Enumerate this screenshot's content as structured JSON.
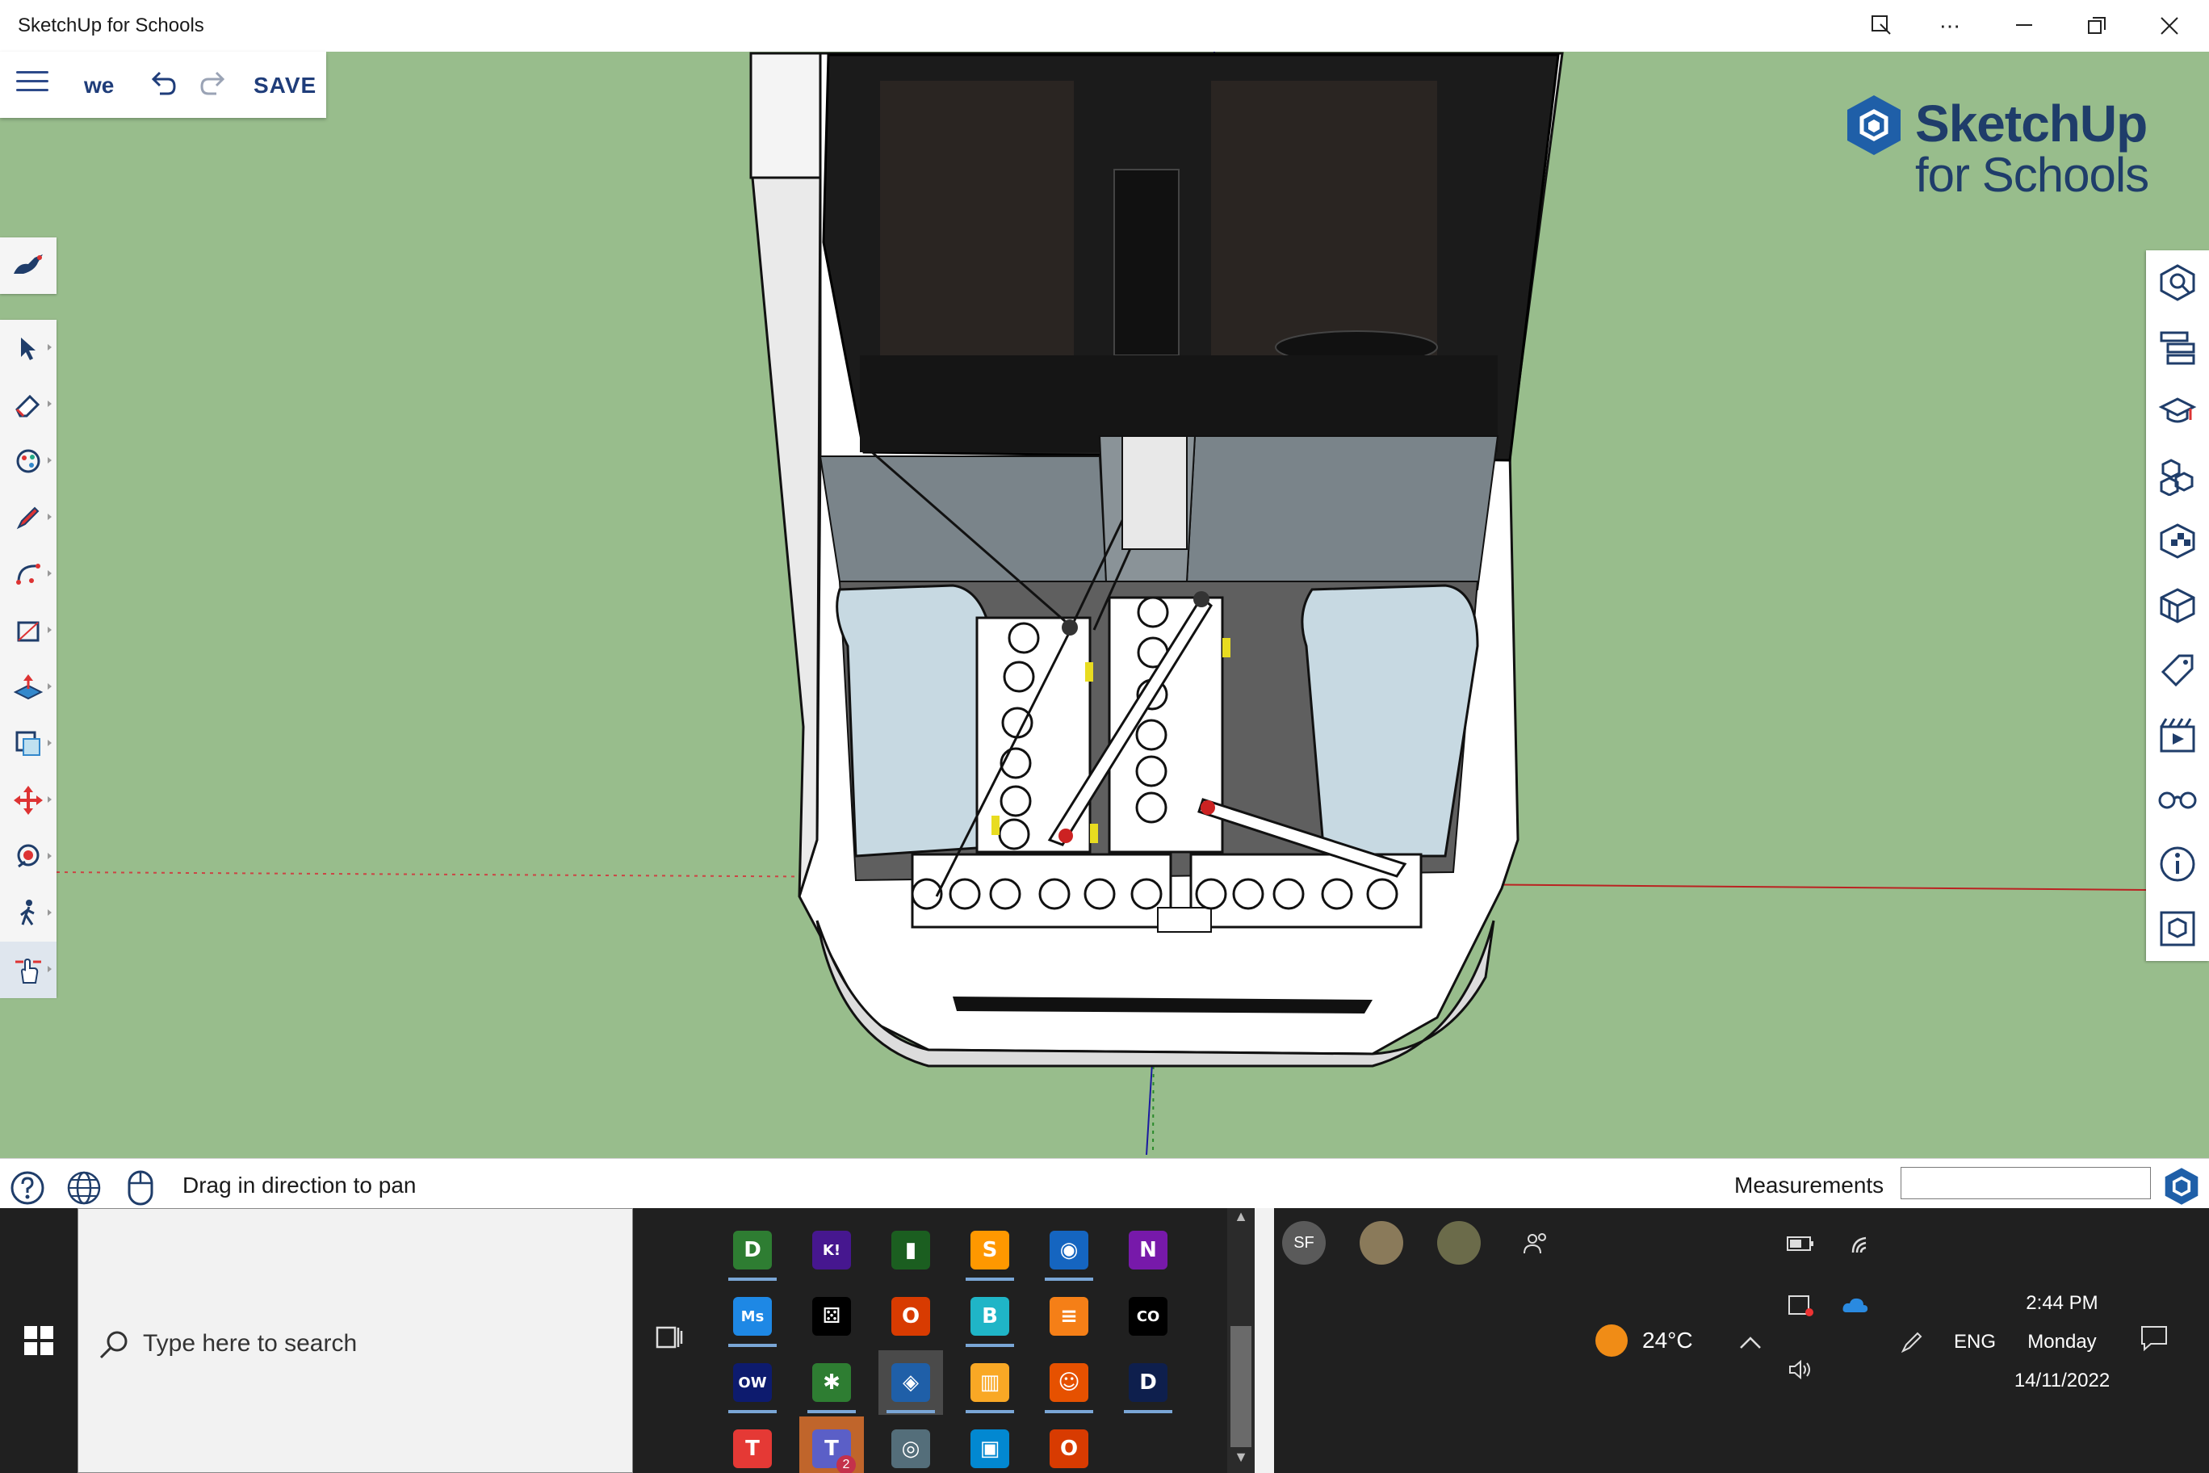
{
  "window": {
    "title": "SketchUp for Schools",
    "controls": [
      "gallery-icon",
      "more-icon",
      "minimize-icon",
      "restore-icon",
      "close-icon"
    ]
  },
  "menu": {
    "file_name": "we",
    "save_label": "SAVE"
  },
  "logo": {
    "line1": "SketchUp",
    "line2": "for Schools"
  },
  "left_toolbar": {
    "top_tool": "search-tool-icon",
    "tools": [
      "select-icon",
      "eraser-icon",
      "paint-bucket-icon",
      "pencil-icon",
      "arc-icon",
      "rectangle-icon",
      "push-pull-icon",
      "offset-icon",
      "move-icon",
      "orbit-icon",
      "walk-icon",
      "pan-icon"
    ],
    "active_tool": "pan-icon"
  },
  "right_toolbar": {
    "tools": [
      "instructor-icon",
      "outliner-icon",
      "learn-icon",
      "components-icon",
      "materials-icon",
      "styles-icon",
      "tags-icon",
      "scenes-icon",
      "display-icon",
      "info-icon",
      "3d-warehouse-icon"
    ]
  },
  "status": {
    "message": "Drag in direction to pan",
    "measurements_label": "Measurements",
    "measurements_value": ""
  },
  "taskbar": {
    "search_placeholder": "Type here to search",
    "apps": [
      {
        "name": "app-d",
        "glyph": "D",
        "color": "#2e7d32"
      },
      {
        "name": "app-kahoot",
        "glyph": "K!",
        "color": "#46178f"
      },
      {
        "name": "app-chart",
        "glyph": "▮",
        "color": "#1b5e20"
      },
      {
        "name": "app-scratch",
        "glyph": "S",
        "color": "#ff9800"
      },
      {
        "name": "app-robot",
        "glyph": "◉",
        "color": "#1565c0"
      },
      {
        "name": "app-onenote",
        "glyph": "N",
        "color": "#7719aa"
      },
      {
        "name": "app-math",
        "glyph": "Ms",
        "color": "#1e88e5"
      },
      {
        "name": "app-dice",
        "glyph": "⚄",
        "color": "#000000"
      },
      {
        "name": "app-office",
        "glyph": "O",
        "color": "#d83b01"
      },
      {
        "name": "app-b",
        "glyph": "B",
        "color": "#1fb5c7"
      },
      {
        "name": "app-stack",
        "glyph": "≡",
        "color": "#f57f17"
      },
      {
        "name": "app-code",
        "glyph": "CO",
        "color": "#000000"
      },
      {
        "name": "app-ow",
        "glyph": "OW",
        "color": "#0d1b6e"
      },
      {
        "name": "app-bug",
        "glyph": "✱",
        "color": "#2e7d32"
      },
      {
        "name": "app-sketchup",
        "glyph": "◈",
        "color": "#1f5fa8"
      },
      {
        "name": "app-piano",
        "glyph": "▥",
        "color": "#f9a825"
      },
      {
        "name": "app-figure",
        "glyph": "☺",
        "color": "#e65100"
      },
      {
        "name": "app-dashlane",
        "glyph": "D",
        "color": "#0e1f4d"
      },
      {
        "name": "app-t",
        "glyph": "T",
        "color": "#e53935"
      },
      {
        "name": "app-teams",
        "glyph": "T",
        "color": "#5b5fc7"
      },
      {
        "name": "app-camera",
        "glyph": "◎",
        "color": "#546e7a"
      },
      {
        "name": "app-remote",
        "glyph": "▣",
        "color": "#0288d1"
      },
      {
        "name": "app-office2",
        "glyph": "O",
        "color": "#d83b01"
      }
    ],
    "teams_badge": "2",
    "people": [
      {
        "name": "avatar-sf",
        "initials": "SF",
        "color": "#5a5a5a"
      },
      {
        "name": "avatar-group",
        "initials": "",
        "color": "#8a7a5a"
      },
      {
        "name": "avatar-person",
        "initials": "",
        "color": "#6b6b4a"
      }
    ],
    "weather_temp": "24°C",
    "language": "ENG",
    "time": "2:44 PM",
    "day": "Monday",
    "date": "14/11/2022"
  },
  "colors": {
    "viewport_bg": "#98bd8c",
    "brand_blue": "#1f3d7a",
    "taskbar_bg": "#202020"
  }
}
